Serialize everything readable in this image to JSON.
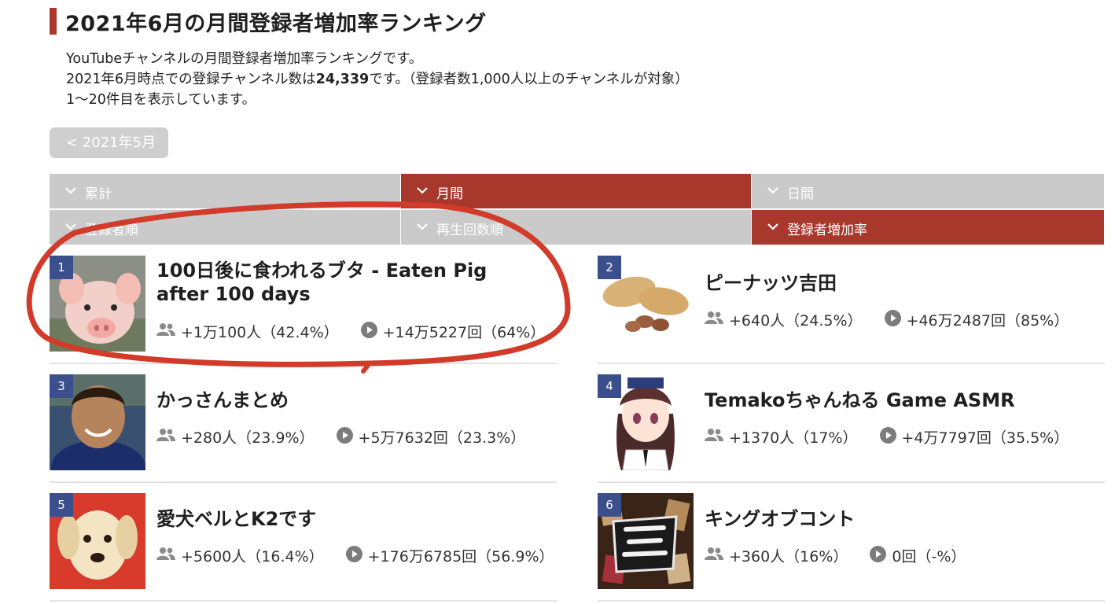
{
  "page": {
    "title": "2021年6月の月間登録者増加率ランキング",
    "desc_line1": "YouTubeチャンネルの月間登録者増加率ランキングです。",
    "desc_line2_pre": "2021年6月時点での登録チャンネル数は",
    "desc_line2_count": "24,339",
    "desc_line2_post": "です。（登録者数1,000人以上のチャンネルが対象）",
    "desc_line3": "1〜20件目を表示しています。",
    "prev_label": "< 2021年5月"
  },
  "tabs": {
    "row1": [
      {
        "label": "累計",
        "active": false
      },
      {
        "label": "月間",
        "active": true
      },
      {
        "label": "日間",
        "active": false
      }
    ],
    "row2": [
      {
        "label": "登録者順",
        "active": false
      },
      {
        "label": "再生回数順",
        "active": false
      },
      {
        "label": "登録者増加率",
        "active": true
      }
    ]
  },
  "colors": {
    "accent": "#a8372c",
    "tab_inactive": "#cacaca",
    "rank_badge": "#3b4f8c",
    "annotation": "#d23a2a"
  },
  "channels": [
    {
      "rank": "1",
      "name": "100日後に食われるブタ - Eaten Pig after 100 days",
      "subs": "+1万100人（42.4%）",
      "views": "+14万5227回（64%）",
      "thumb": "pig"
    },
    {
      "rank": "2",
      "name": "ピーナッツ吉田",
      "subs": "+640人（24.5%）",
      "views": "+46万2487回（85%）",
      "thumb": "peanuts"
    },
    {
      "rank": "3",
      "name": "かっさんまとめ",
      "subs": "+280人（23.9%）",
      "views": "+5万7632回（23.3%）",
      "thumb": "person"
    },
    {
      "rank": "4",
      "name": "Temakoちゃんねる Game ASMR",
      "subs": "+1370人（17%）",
      "views": "+4万7797回（35.5%）",
      "thumb": "anime-girl"
    },
    {
      "rank": "5",
      "name": "愛犬ベルとK2です",
      "subs": "+5600人（16.4%）",
      "views": "+176万6785回（56.9%）",
      "thumb": "puppy"
    },
    {
      "rank": "6",
      "name": "キングオブコント",
      "subs": "+360人（16%）",
      "views": "0回（-%）",
      "thumb": "king-of-conte-logo"
    }
  ],
  "icons": {
    "subscribers": "users-icon",
    "views": "play-circle-icon",
    "tab": "chevron-down-icon"
  }
}
